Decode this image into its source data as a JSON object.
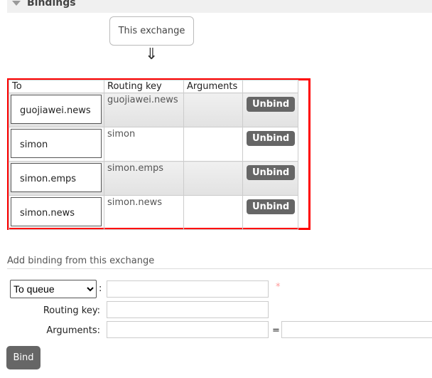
{
  "section": {
    "title": "Bindings"
  },
  "source_label": "This exchange",
  "arrow": "⇓",
  "table": {
    "headers": [
      "To",
      "Routing key",
      "Arguments",
      ""
    ],
    "rows": [
      {
        "to": "guojiawei.news",
        "routing_key": "guojiawei.news",
        "arguments": "",
        "action": "Unbind"
      },
      {
        "to": "simon",
        "routing_key": "simon",
        "arguments": "",
        "action": "Unbind"
      },
      {
        "to": "simon.emps",
        "routing_key": "simon.emps",
        "arguments": "",
        "action": "Unbind"
      },
      {
        "to": "simon.news",
        "routing_key": "simon.news",
        "arguments": "",
        "action": "Unbind"
      }
    ]
  },
  "add_binding": {
    "title": "Add binding from this exchange",
    "destination_type": "To queue",
    "destination_options": [
      "To queue"
    ],
    "colon": ":",
    "required_mark": "*",
    "routing_key_label": "Routing key:",
    "arguments_label": "Arguments:",
    "equals": "=",
    "bind_label": "Bind"
  }
}
